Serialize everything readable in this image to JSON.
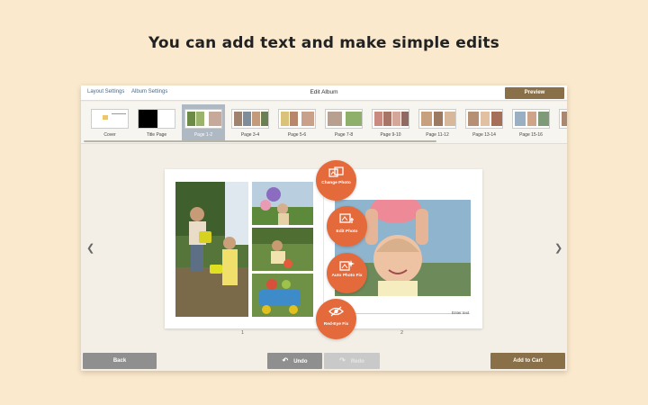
{
  "headline": "You can add text and make simple edits",
  "topbar": {
    "layout_settings": "Layout Settings",
    "album_settings": "Album Settings",
    "title": "Edit Album",
    "preview": "Preview"
  },
  "thumbnails": [
    {
      "label": "Cover"
    },
    {
      "label": "Title Page"
    },
    {
      "label": "Page 1-2"
    },
    {
      "label": "Page 3-4"
    },
    {
      "label": "Page 5-6"
    },
    {
      "label": "Page 7-8"
    },
    {
      "label": "Page 9-10"
    },
    {
      "label": "Page 11-12"
    },
    {
      "label": "Page 13-14"
    },
    {
      "label": "Page 15-16"
    }
  ],
  "editor": {
    "left_page_number": "1",
    "right_page_number": "2",
    "text_placeholder": "Enter text."
  },
  "actions": {
    "change_photo": "Change Photo",
    "edit_photo": "Edit Photo",
    "auto_photo_fix": "Auto Photo Fix",
    "red_eye_fix": "Red-Eye Fix"
  },
  "bottombar": {
    "back": "Back",
    "undo": "Undo",
    "redo": "Redo",
    "add_to_cart": "Add to Cart"
  },
  "icons": {
    "prev": "chevron-left-icon",
    "next": "chevron-right-icon",
    "undo": "undo-arrow-icon",
    "redo": "redo-arrow-icon"
  },
  "colors": {
    "background": "#fbe9cd",
    "accent_orange": "#e46a3c",
    "brand_brown": "#8a7048",
    "selected_thumb": "#aeb9c4"
  }
}
